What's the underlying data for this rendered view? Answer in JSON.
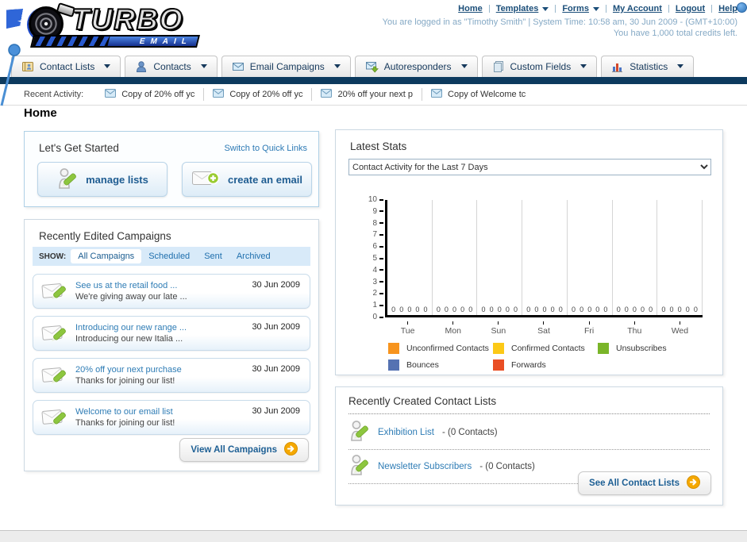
{
  "header": {
    "logo": {
      "line1": "TURBO",
      "line2": "EMAIL"
    },
    "links": [
      {
        "label": "Home"
      },
      {
        "label": "Templates",
        "dropdown": true
      },
      {
        "label": "Forms",
        "dropdown": true
      },
      {
        "label": "My Account"
      },
      {
        "label": "Logout"
      },
      {
        "label": "Help"
      }
    ],
    "login_info": "You are logged in as \"Timothy Smith\" | System Time: 10:58 am, 30 Jun 2009 - (GMT+10:00)",
    "credits_info": "You have 1,000 total credits left."
  },
  "nav": {
    "tabs": [
      {
        "label": "Contact Lists",
        "icon": "contact-lists-icon"
      },
      {
        "label": "Contacts",
        "icon": "contacts-icon"
      },
      {
        "label": "Email Campaigns",
        "icon": "email-campaigns-icon"
      },
      {
        "label": "Autoresponders",
        "icon": "autoresponders-icon"
      },
      {
        "label": "Custom Fields",
        "icon": "custom-fields-icon"
      },
      {
        "label": "Statistics",
        "icon": "statistics-icon"
      }
    ]
  },
  "recent_activity": {
    "label": "Recent Activity:",
    "items": [
      "Copy of 20% off yc",
      "Copy of 20% off yc",
      "20% off your next p",
      "Copy of Welcome tc"
    ]
  },
  "page_title": "Home",
  "get_started": {
    "title": "Let's Get Started",
    "switch_link": "Switch to Quick Links",
    "buttons": [
      {
        "label": "manage lists",
        "icon": "person-pencil-icon"
      },
      {
        "label": "create an email",
        "icon": "envelope-plus-icon"
      }
    ]
  },
  "campaigns": {
    "title": "Recently Edited Campaigns",
    "show_label": "SHOW:",
    "tabs": [
      {
        "label": "All Campaigns",
        "active": true
      },
      {
        "label": "Scheduled",
        "active": false
      },
      {
        "label": "Sent",
        "active": false
      },
      {
        "label": "Archived",
        "active": false
      }
    ],
    "items": [
      {
        "title": "See us at the retail food ...",
        "subtitle": "We're giving away our late ...",
        "date": "30 Jun 2009"
      },
      {
        "title": "Introducing our new range ...",
        "subtitle": "Introducing our new Italia ...",
        "date": "30 Jun 2009"
      },
      {
        "title": "20% off your next purchase",
        "subtitle": "Thanks for joining our list!",
        "date": "30 Jun 2009"
      },
      {
        "title": "Welcome to our email list",
        "subtitle": "Thanks for joining our list!",
        "date": "30 Jun 2009"
      }
    ],
    "view_all_label": "View All Campaigns"
  },
  "stats": {
    "title": "Latest Stats",
    "selected_option": "Contact Activity for the Last 7 Days"
  },
  "chart_data": {
    "type": "bar",
    "title": "Contact Activity for the Last 7 Days",
    "categories": [
      "Tue",
      "Mon",
      "Sun",
      "Sat",
      "Fri",
      "Thu",
      "Wed"
    ],
    "series": [
      {
        "name": "Unconfirmed Contacts",
        "color": "#F7941E",
        "values": [
          0,
          0,
          0,
          0,
          0,
          0,
          0
        ]
      },
      {
        "name": "Confirmed Contacts",
        "color": "#FCC917",
        "values": [
          0,
          0,
          0,
          0,
          0,
          0,
          0
        ]
      },
      {
        "name": "Unsubscribes",
        "color": "#7AB529",
        "values": [
          0,
          0,
          0,
          0,
          0,
          0,
          0
        ]
      },
      {
        "name": "Bounces",
        "color": "#5572B2",
        "values": [
          0,
          0,
          0,
          0,
          0,
          0,
          0
        ]
      },
      {
        "name": "Forwards",
        "color": "#E94E24",
        "values": [
          0,
          0,
          0,
          0,
          0,
          0,
          0
        ]
      }
    ],
    "ylim": [
      0,
      10
    ],
    "yticks": [
      0,
      1,
      2,
      3,
      4,
      5,
      6,
      7,
      8,
      9,
      10
    ],
    "xlabel": "",
    "ylabel": "",
    "grid": "vertical",
    "legend_position": "bottom"
  },
  "contact_lists": {
    "title": "Recently Created Contact Lists",
    "items": [
      {
        "name": "Exhibition List",
        "count": "- (0 Contacts)"
      },
      {
        "name": "Newsletter Subscribers",
        "count": "- (0 Contacts)"
      }
    ],
    "see_all_label": "See All Contact Lists"
  },
  "colors": {
    "navy_bar": "#0d3a5e",
    "link_blue": "#2e7cb5",
    "header_link": "#1b4e79",
    "button_text": "#1e5c91",
    "arrow_button_orange": "#f5a800",
    "tabbar_blue": "#d8eaf9",
    "pencil_green": "#8dc63f"
  }
}
